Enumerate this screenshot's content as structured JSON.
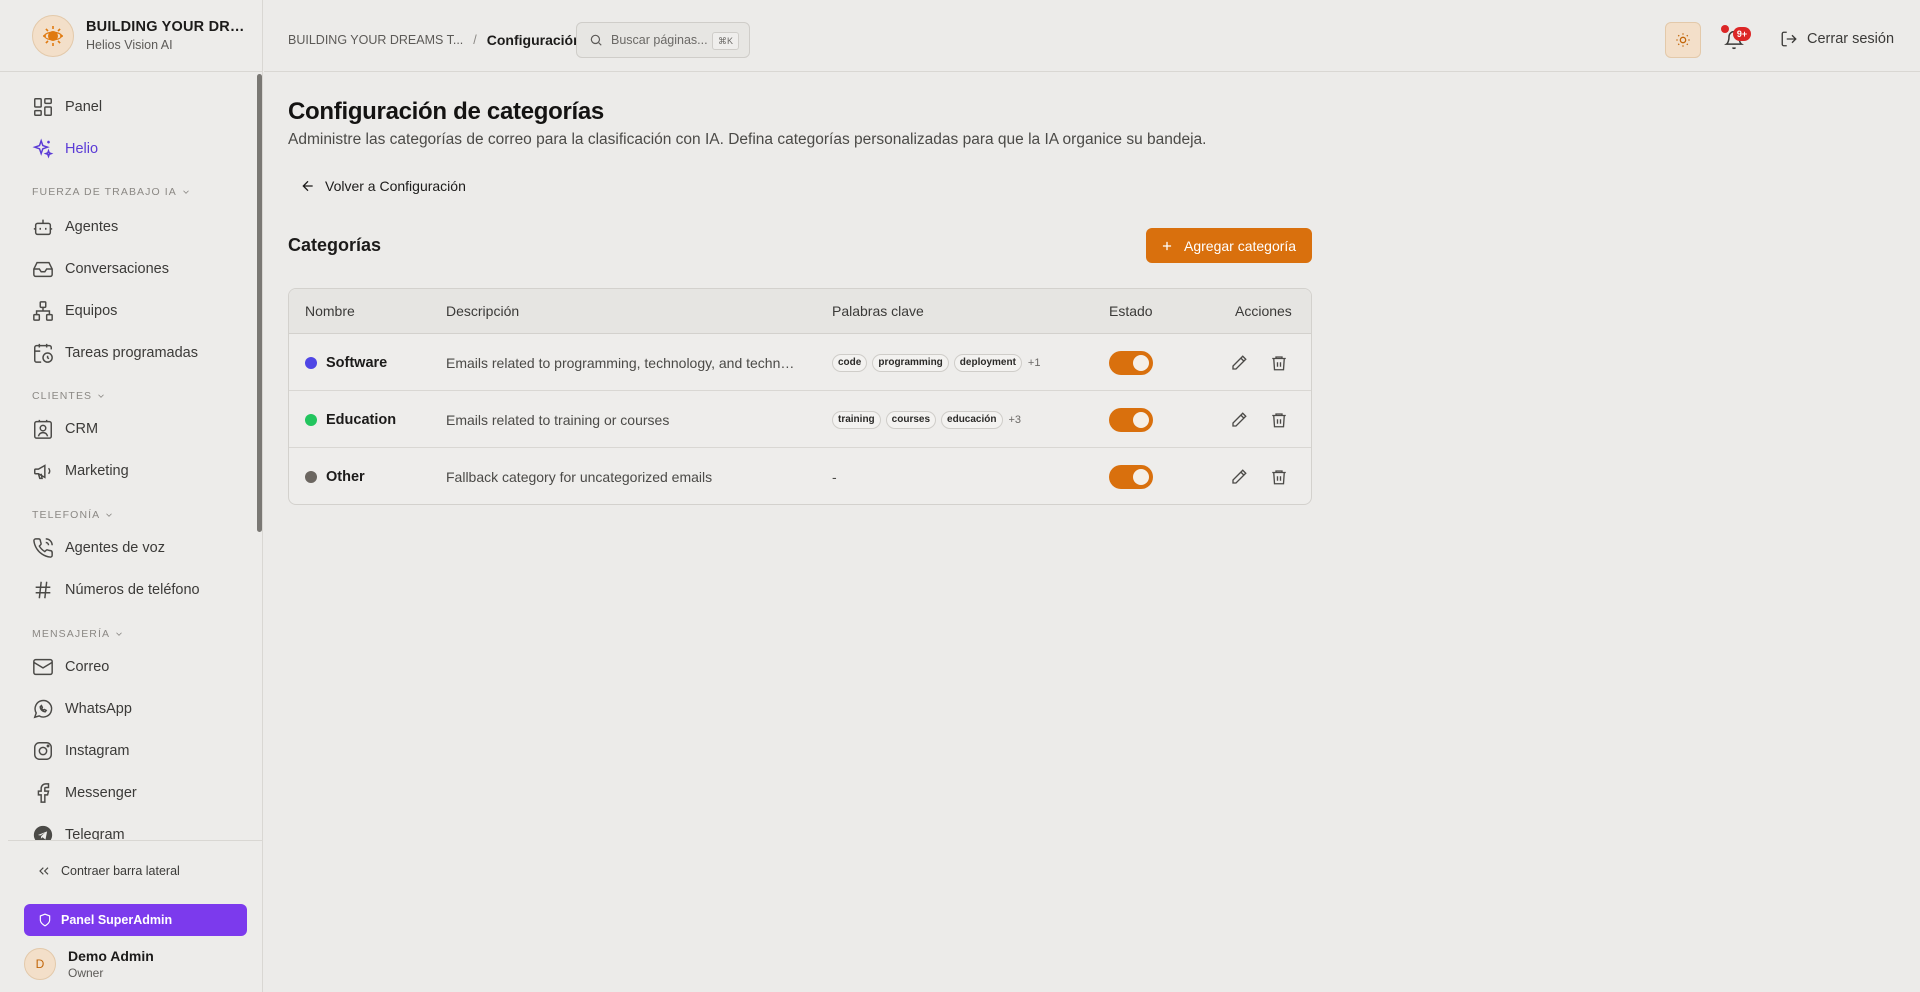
{
  "brand": {
    "title": "BUILDING YOUR DRE...",
    "subtitle": "Helios Vision AI"
  },
  "sidebar": {
    "items": [
      {
        "label": "Panel",
        "icon": "dashboard-icon"
      },
      {
        "label": "Helio",
        "icon": "sparkles-icon",
        "active": true
      }
    ],
    "sections": [
      {
        "label": "FUERZA DE TRABAJO IA",
        "items": [
          {
            "label": "Agentes",
            "icon": "bot-icon"
          },
          {
            "label": "Conversaciones",
            "icon": "inbox-icon"
          },
          {
            "label": "Equipos",
            "icon": "network-icon"
          },
          {
            "label": "Tareas programadas",
            "icon": "calendar-clock-icon"
          }
        ]
      },
      {
        "label": "CLIENTES",
        "items": [
          {
            "label": "CRM",
            "icon": "contact-icon"
          },
          {
            "label": "Marketing",
            "icon": "megaphone-icon"
          }
        ]
      },
      {
        "label": "TELEFONÍA",
        "items": [
          {
            "label": "Agentes de voz",
            "icon": "phone-icon"
          },
          {
            "label": "Números de teléfono",
            "icon": "hash-icon"
          }
        ]
      },
      {
        "label": "MENSAJERÍA",
        "items": [
          {
            "label": "Correo",
            "icon": "mail-icon"
          },
          {
            "label": "WhatsApp",
            "icon": "whatsapp-icon"
          },
          {
            "label": "Instagram",
            "icon": "instagram-icon"
          },
          {
            "label": "Messenger",
            "icon": "facebook-icon"
          },
          {
            "label": "Telegram",
            "icon": "telegram-icon"
          }
        ]
      }
    ],
    "collapse_label": "Contraer barra lateral",
    "superadmin_label": "Panel SuperAdmin",
    "user": {
      "initial": "D",
      "name": "Demo Admin",
      "role": "Owner"
    }
  },
  "header": {
    "breadcrumb_root": "BUILDING YOUR DREAMS T...",
    "breadcrumb_sep": "/",
    "breadcrumb_current": "Configuración",
    "search_placeholder": "Buscar páginas...",
    "search_shortcut": "⌘K",
    "notification_badge": "9+",
    "logout_label": "Cerrar sesión"
  },
  "main": {
    "title": "Configuración de categorías",
    "description": "Administre las categorías de correo para la clasificación con IA. Defina categorías personalizadas para que la IA organice su bandeja.",
    "back_label": "Volver a Configuración",
    "section_title": "Categorías",
    "add_label": "Agregar categoría"
  },
  "table": {
    "columns": [
      "Nombre",
      "Descripción",
      "Palabras clave",
      "Estado",
      "Acciones"
    ],
    "rows": [
      {
        "name": "Software",
        "color": "#4f46e5",
        "description": "Emails related to programming, technology, and technology",
        "keywords": [
          "code",
          "programming",
          "deployment"
        ],
        "more": "+1",
        "enabled": true
      },
      {
        "name": "Education",
        "color": "#22c55e",
        "description": "Emails related to training or courses",
        "keywords": [
          "training",
          "courses",
          "educación"
        ],
        "more": "+3",
        "enabled": true
      },
      {
        "name": "Other",
        "color": "#6b6660",
        "description": "Fallback category for uncategorized emails",
        "keywords": [],
        "empty_keywords": "-",
        "enabled": true
      }
    ]
  },
  "colors": {
    "accent": "#d9700d",
    "active_nav": "#5b3bd6",
    "superadmin": "#7c3aed",
    "notification": "#dc2626"
  }
}
